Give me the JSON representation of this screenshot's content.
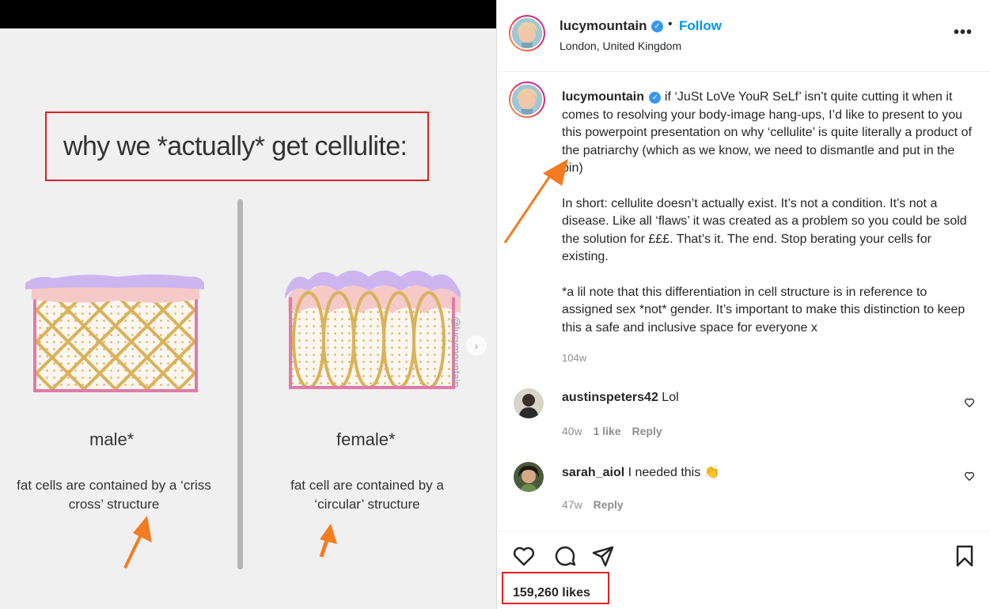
{
  "slide": {
    "title": "why we *actually* get cellulite:",
    "male_label": "male*",
    "male_desc": "fat cells are contained by a ‘criss cross’ structure",
    "female_label": "female*",
    "female_desc": "fat cell are contained by a ‘circular’ structure",
    "watermark": "@lucymountain",
    "next_glyph": "›"
  },
  "header": {
    "username": "lucymountain",
    "verified_glyph": "✓",
    "separator": "•",
    "follow_label": "Follow",
    "location": "London, United Kingdom",
    "more_glyph": "•••"
  },
  "caption": {
    "username": "lucymountain",
    "p1": "if ‘JuSt LoVe YouR SeLf’ isn’t quite cutting it when it comes to resolving your body-image hang-ups, I’d like to present to you this powerpoint presentation on why ‘cellulite’ is quite literally a product of the patriarchy (which as we know, we need to dismantle and put in the bin)",
    "p2": "In short: cellulite doesn’t actually exist. It’s not a condition. It’s not a disease. Like all ‘flaws’ it was created as a problem so you could be sold the solution for £££. That’s it. The end. Stop berating your cells for existing.",
    "p3": "*a lil note that this differentiation in cell structure is in reference to assigned sex *not* gender. It’s important to make this distinction to keep this a safe and inclusive space for everyone x",
    "age": "104w"
  },
  "comments": [
    {
      "username": "austinspeters42",
      "text": "Lol",
      "age": "40w",
      "likes": "1 like",
      "reply": "Reply"
    },
    {
      "username": "sarah_aiol",
      "text": "I needed this",
      "emoji": "👏",
      "age": "47w",
      "reply": "Reply"
    }
  ],
  "actions": {
    "likes": "159,260 likes"
  },
  "icons": {
    "verified": "verified-badge-icon",
    "more": "more-options-icon",
    "heart": "heart-icon",
    "comment": "comment-icon",
    "share": "share-icon",
    "save": "bookmark-icon",
    "next": "chevron-right-icon"
  },
  "colors": {
    "annotation": "#e0221e",
    "arrow": "#f47b20",
    "follow": "#0095f6",
    "verified": "#3897f0",
    "cell_wall": "#e07aa8",
    "cell_fat": "#f6c9c9",
    "cell_top": "#cdb6f0",
    "cell_fiber": "#d9b25c"
  }
}
